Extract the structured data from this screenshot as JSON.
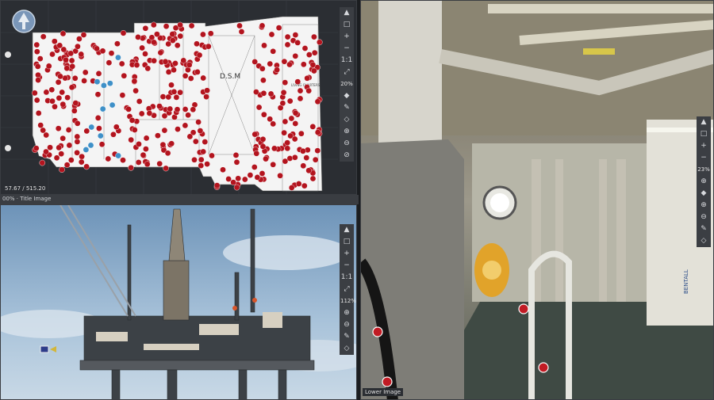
{
  "plan": {
    "coords": "57.67 / 515.20",
    "zoom": "20%",
    "room_label": "D.S.M",
    "room_label_2": "LIVING QUARTERS",
    "tools": [
      "▲",
      "□",
      "+",
      "−",
      "1:1",
      "⤢",
      "◆",
      "✎",
      "◇",
      "⊕",
      "⊖",
      "⊘"
    ]
  },
  "divider": {
    "tab": "00% · Title Image"
  },
  "photo": {
    "zoom": "112%",
    "tools": [
      "▲",
      "□",
      "+",
      "−",
      "1:1",
      "⤢",
      "⊕",
      "⊖",
      "✎",
      "◇"
    ]
  },
  "pano": {
    "zoom": "23%",
    "caption": "Lower Image",
    "tools": [
      "▲",
      "□",
      "+",
      "−",
      "⊕",
      "◆",
      "⊕",
      "⊖",
      "✎",
      "◇"
    ],
    "brand": "BENTALL"
  },
  "colors": {
    "marker_red": "#b3141e",
    "marker_blue": "#3e90c8",
    "panel_bg": "#2b2e33"
  }
}
